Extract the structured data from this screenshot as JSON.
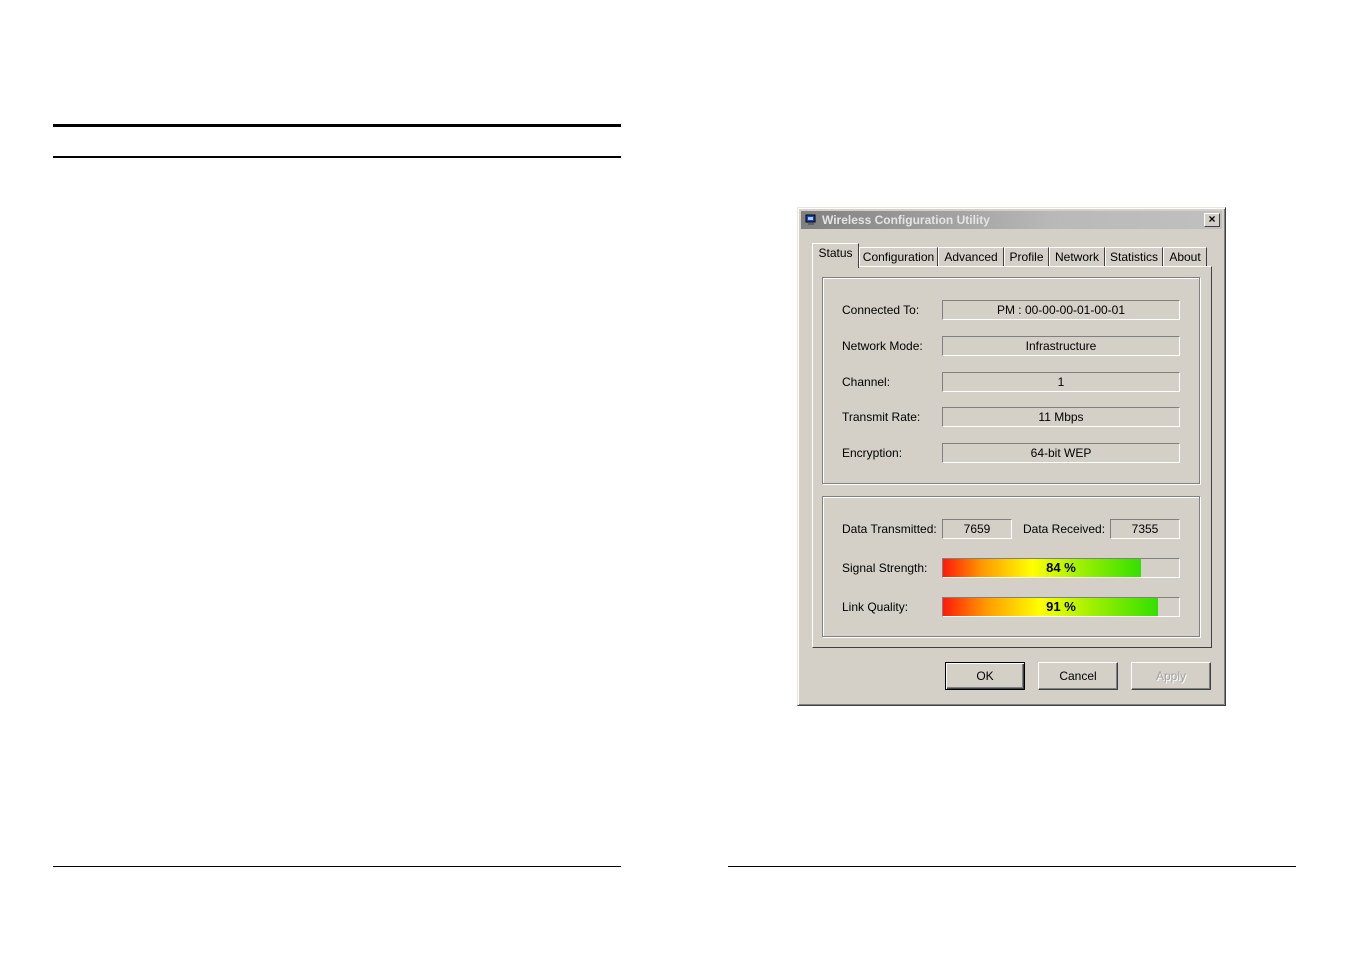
{
  "window": {
    "title": "Wireless Configuration Utility"
  },
  "tabs": [
    "Status",
    "Configuration",
    "Advanced",
    "Profile",
    "Network",
    "Statistics",
    "About"
  ],
  "active_tab": "Status",
  "status": {
    "connected_to_label": "Connected To:",
    "connected_to_value": "PM : 00-00-00-01-00-01",
    "network_mode_label": "Network Mode:",
    "network_mode_value": "Infrastructure",
    "channel_label": "Channel:",
    "channel_value": "1",
    "transmit_rate_label": "Transmit Rate:",
    "transmit_rate_value": "11 Mbps",
    "encryption_label": "Encryption:",
    "encryption_value": "64-bit WEP"
  },
  "traffic": {
    "data_transmitted_label": "Data Transmitted:",
    "data_transmitted_value": "7659",
    "data_received_label": "Data Received:",
    "data_received_value": "7355",
    "signal_strength_label": "Signal Strength:",
    "signal_strength_text": "84 %",
    "signal_strength_percent": 84,
    "link_quality_label": "Link Quality:",
    "link_quality_text": "91 %",
    "link_quality_percent": 91
  },
  "buttons": {
    "ok": "OK",
    "cancel": "Cancel",
    "apply": "Apply"
  },
  "icons": {
    "app": "network-adapter-icon",
    "close": "close-icon"
  }
}
